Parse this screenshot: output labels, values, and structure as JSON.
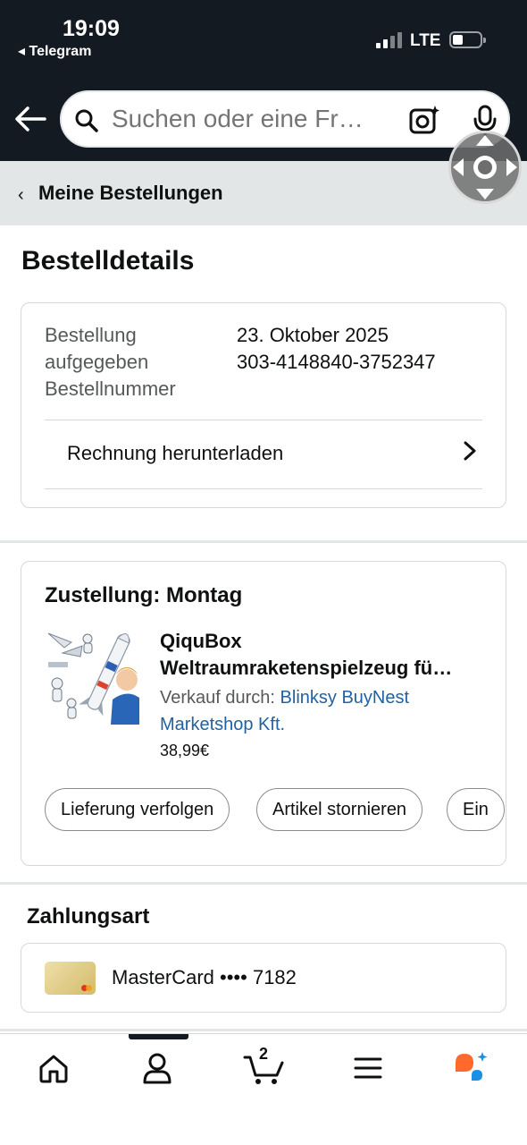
{
  "status_bar": {
    "time": "19:09",
    "back_app": "◂ Telegram",
    "network": "LTE",
    "signal_icon": "signal-bars-icon",
    "battery_icon": "battery-low-icon"
  },
  "header": {
    "back_icon": "back-arrow-icon",
    "search_placeholder": "Suchen oder eine Fr…",
    "search_icon": "search-icon",
    "lens_icon": "camera-lens-icon",
    "mic_icon": "microphone-icon"
  },
  "breadcrumb": {
    "chevron": "‹",
    "label": "Meine Bestellungen"
  },
  "page": {
    "title": "Bestelldetails"
  },
  "order_info": {
    "rows": [
      {
        "label": "Bestellung aufgegeben",
        "value": "23. Oktober 2025"
      },
      {
        "label": "Bestellnummer",
        "value": "303-4148840-3752347"
      }
    ],
    "label_line1": "Bestellung",
    "label_line2": "aufgegeben",
    "label_line3": "Bestellnummer",
    "order_date": "23. Oktober 2025",
    "order_number": "303-4148840-3752347",
    "invoice_link": "Rechnung herunterladen"
  },
  "shipment": {
    "delivery": "Zustellung: Montag",
    "product_title_line1": "QiquBox",
    "product_title_line2": "Weltraumraketenspielzeug fü…",
    "seller_prefix": "Verkauf durch: ",
    "seller_name": "Blinksy BuyNest Marketshop Kft.",
    "price": "38,99€",
    "actions": [
      "Lieferung verfolgen",
      "Artikel stornieren",
      "Ein"
    ]
  },
  "payment": {
    "title": "Zahlungsart",
    "card_text": "MasterCard •••• 7182"
  },
  "bottom_nav": {
    "items": [
      "home-icon",
      "account-icon",
      "cart-icon",
      "menu-icon",
      "rufus-ai-icon"
    ],
    "cart_count": "2",
    "active_index": 1
  },
  "colors": {
    "header_bg": "#131a22",
    "link": "#2162a1",
    "divider": "#d5d9d9",
    "breadcrumb_bg": "#e3e6e6",
    "rufus_orange": "#ff6a2c",
    "rufus_blue": "#1a8fe3"
  }
}
